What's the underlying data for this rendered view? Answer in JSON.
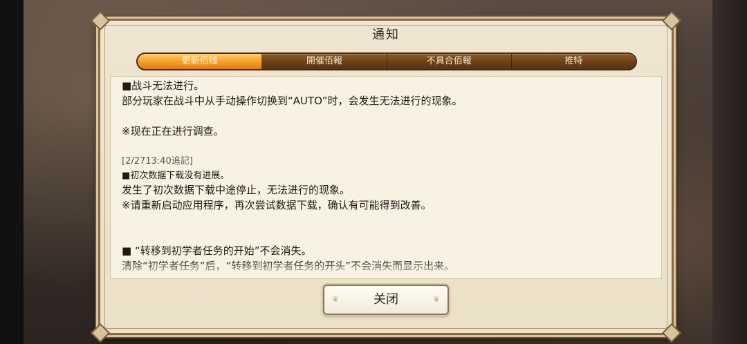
{
  "dialog": {
    "title": "通知",
    "tabs": [
      {
        "label": "更新佰线",
        "active": true
      },
      {
        "label": "開催佰報",
        "active": false
      },
      {
        "label": "不具合佰報",
        "active": false
      },
      {
        "label": "推特",
        "active": false
      }
    ],
    "content": {
      "p1_heading": "■战斗无法进行。",
      "p1_body": "部分玩家在战斗中从手动操作切换到“AUTO”时，会发生无法进行的现象。",
      "p1_note": "※现在正在进行调查。",
      "p2_stamp": "[2/2713:40追記]",
      "p2_heading": "■初次数据下载没有进展。",
      "p2_body": "发生了初次数据下载中途停止，无法进行的现象。",
      "p2_note": "※请重新启动应用程序，再次尝试数据下载，确认有可能得到改善。",
      "p3_heading": "■ “转移到初学者任务的开始”不会消失。",
      "p3_body": "清除“初学者任务”后，“转移到初学者任务的开头”不会消失而显示出来。"
    },
    "close_label": "关闭"
  },
  "colors": {
    "tab_active": "#f59d2a",
    "tab_bar": "#6b3f17",
    "frame": "#8a6a44",
    "panel": "#f8f2e2"
  }
}
